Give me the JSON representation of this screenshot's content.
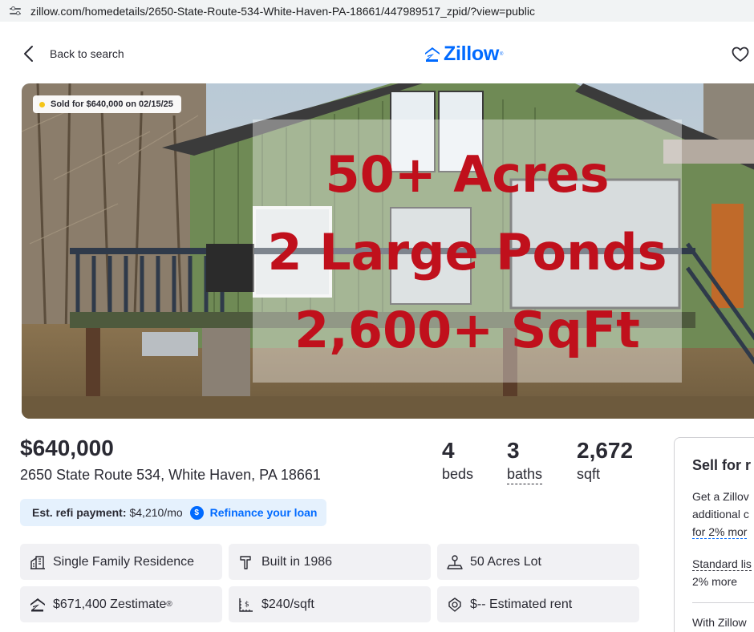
{
  "browser": {
    "url": "zillow.com/homedetails/2650-State-Route-534-White-Haven-PA-18661/447989517_zpid/?view=public"
  },
  "header": {
    "back_label": "Back to search",
    "logo_text": "Zillow",
    "logo_mark": "®",
    "brand_color": "#006aff"
  },
  "hero": {
    "sold_badge": "Sold for $640,000 on 02/15/25",
    "badge_dot_color": "#f5c518",
    "overlay_lines": [
      "50+ Acres",
      "2 Large Ponds",
      "2,600+ SqFt"
    ],
    "overlay_color": "#c0101c"
  },
  "summary": {
    "price": "$640,000",
    "address": "2650 State Route 534, White Haven, PA 18661",
    "beds_value": "4",
    "beds_label": "beds",
    "baths_value": "3",
    "baths_label": "baths",
    "sqft_value": "2,672",
    "sqft_label": "sqft"
  },
  "refi": {
    "label": "Est. refi payment:",
    "value": "$4,210/mo",
    "icon": "$",
    "link": "Refinance your loan"
  },
  "facts": [
    {
      "icon": "building-icon",
      "text": "Single Family Residence"
    },
    {
      "icon": "hammer-icon",
      "text": "Built in 1986"
    },
    {
      "icon": "lot-icon",
      "text": "50 Acres Lot"
    },
    {
      "icon": "zestimate-icon",
      "text": "$671,400 Zestimate",
      "sup": "®"
    },
    {
      "icon": "price-sqft-icon",
      "text": "$240/sqft"
    },
    {
      "icon": "rent-icon",
      "text": "$-- Estimated rent"
    }
  ],
  "sell_card": {
    "title": "Sell for r",
    "line1": "Get a Zillov",
    "line2": "additional c",
    "line3": "for 2% mor",
    "line4": "Standard lis",
    "line5": "2% more",
    "line6": "With Zillow"
  }
}
